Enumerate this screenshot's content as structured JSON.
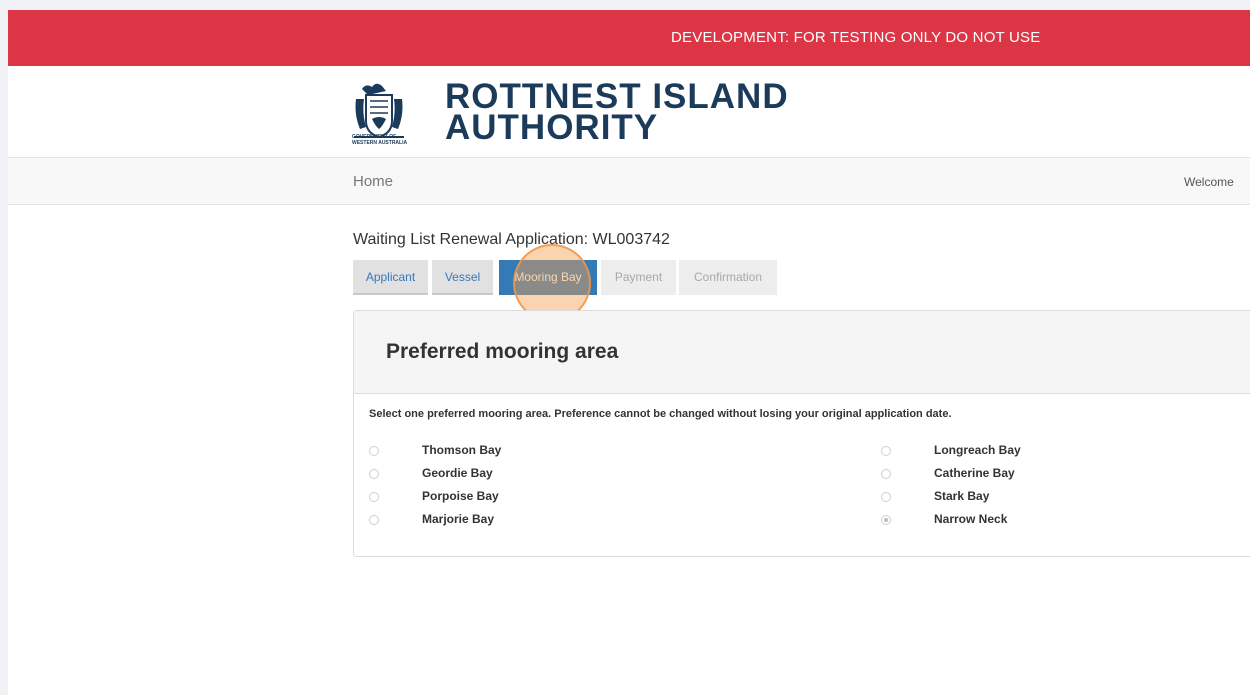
{
  "banner": {
    "text": "DEVELOPMENT: FOR TESTING ONLY DO NOT USE",
    "color": "#dc3545"
  },
  "logo": {
    "crest_caption_line1": "GOVERNMENT OF",
    "crest_caption_line2": "WESTERN AUSTRALIA",
    "title_line1": "ROTTNEST ISLAND",
    "title_line2": "AUTHORITY",
    "brand_color": "#1c3a5a"
  },
  "navbar": {
    "home": "Home",
    "welcome": "Welcome"
  },
  "application": {
    "title": "Waiting List Renewal Application: WL003742"
  },
  "tabs": [
    {
      "label": "Applicant",
      "state": "enabled"
    },
    {
      "label": "Vessel",
      "state": "enabled"
    },
    {
      "label": "Mooring Bay",
      "state": "active"
    },
    {
      "label": "Payment",
      "state": "disabled"
    },
    {
      "label": "Confirmation",
      "state": "disabled"
    }
  ],
  "mooring": {
    "heading": "Preferred mooring area",
    "instructions": "Select one preferred mooring area. Preference cannot be changed without losing your original application date.",
    "selected": "Narrow Neck",
    "left_options": [
      "Thomson Bay",
      "Geordie Bay",
      "Porpoise Bay",
      "Marjorie Bay"
    ],
    "right_options": [
      "Longreach Bay",
      "Catherine Bay",
      "Stark Bay",
      "Narrow Neck"
    ]
  },
  "colors": {
    "accent": "#337ab7",
    "tab_bg": "#e1e1e1"
  }
}
